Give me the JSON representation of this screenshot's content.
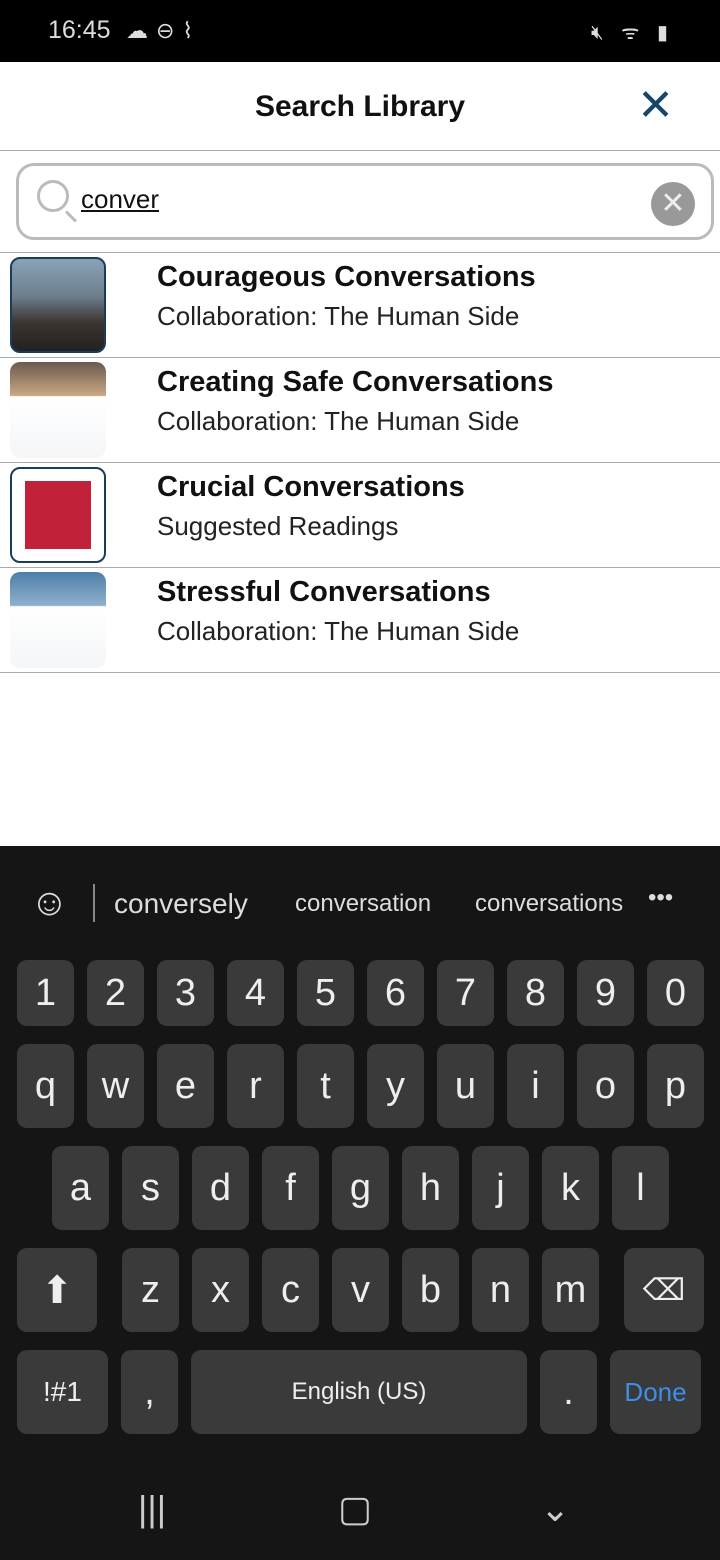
{
  "status": {
    "time": "16:45",
    "left_icons": [
      "cloud-icon",
      "dnd-icon",
      "missed-call-icon"
    ],
    "right_icons": [
      "mute-icon",
      "wifi-icon",
      "signal-icon",
      "battery-charging-icon"
    ]
  },
  "header": {
    "title": "Search Library",
    "close_icon": "close-icon",
    "accent": "#17466b"
  },
  "search": {
    "value": "conver",
    "placeholder": ""
  },
  "results": [
    {
      "title": "Courageous Conversations",
      "subtitle": "Collaboration: The Human Side"
    },
    {
      "title": "Creating Safe Conversations",
      "subtitle": "Collaboration: The Human Side"
    },
    {
      "title": "Crucial Conversations",
      "subtitle": "Suggested Readings"
    },
    {
      "title": "Stressful Conversations",
      "subtitle": "Collaboration: The Human Side"
    }
  ],
  "keyboard": {
    "suggestions": [
      "conversely",
      "conversation",
      "conversations"
    ],
    "numbers": [
      "1",
      "2",
      "3",
      "4",
      "5",
      "6",
      "7",
      "8",
      "9",
      "0"
    ],
    "row1": [
      "q",
      "w",
      "e",
      "r",
      "t",
      "y",
      "u",
      "i",
      "o",
      "p"
    ],
    "row2": [
      "a",
      "s",
      "d",
      "f",
      "g",
      "h",
      "j",
      "k",
      "l"
    ],
    "row3": [
      "z",
      "x",
      "c",
      "v",
      "b",
      "n",
      "m"
    ],
    "symbols": "!#1",
    "comma": ",",
    "space": "English (US)",
    "period": ".",
    "done": "Done",
    "done_color": "#3d8ee8"
  }
}
